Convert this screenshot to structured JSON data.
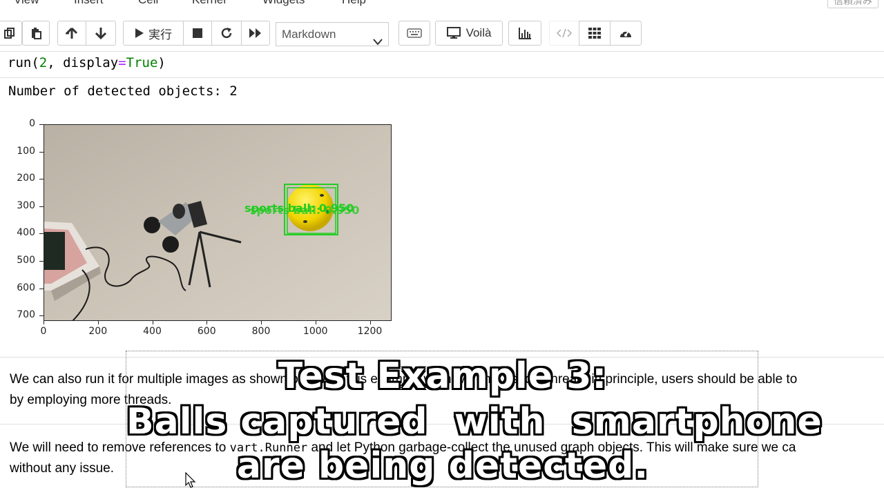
{
  "menubar": {
    "items": [
      "View",
      "Insert",
      "Cell",
      "Kernel",
      "Widgets",
      "Help"
    ],
    "trusted": "信頼済み"
  },
  "toolbar": {
    "run_label": "実行",
    "cell_type": "Markdown",
    "voila_label": "Voilà",
    "icons": [
      "copy-icon",
      "paste-icon",
      "arrow-up-icon",
      "arrow-down-icon",
      "play-icon",
      "stop-icon",
      "restart-icon",
      "fast-forward-icon",
      "keyboard-icon",
      "monitor-icon",
      "bar-chart-icon",
      "code-icon",
      "grid-icon",
      "dashboard-icon"
    ]
  },
  "code_cell": {
    "fn": "run(",
    "arg1": "2",
    "mid": ", display",
    "eq": "=",
    "kw": "True",
    "close": ")"
  },
  "output": {
    "text": "Number of detected objects: 2",
    "detection_label": "sports ball: 0.950"
  },
  "chart_data": {
    "type": "image",
    "x_ticks": [
      "0",
      "200",
      "400",
      "600",
      "800",
      "1000",
      "1200"
    ],
    "y_ticks": [
      "0",
      "100",
      "200",
      "300",
      "400",
      "500",
      "600",
      "700"
    ],
    "xlim": [
      0,
      1280
    ],
    "ylim": [
      720,
      0
    ]
  },
  "markdown": {
    "p1_line1": "We can also run it for multiple images as shown below. In this example we have only used 1 thread; in principle, users should be able to",
    "p1_line2": "by employing more threads.",
    "p2_line1a": "We will need to remove references to ",
    "p2_code": "vart.Runner",
    "p2_line1b": " and let Python garbage-collect the unused graph objects. This will make sure we ca",
    "p2_line2": "without any issue."
  },
  "subtitle": {
    "line1": "Test Example 3:",
    "line2": "Balls captured  with  smartphone",
    "line3": "are being detected."
  },
  "colors": {
    "detection_box": "#22cc22",
    "code_number": "#008000",
    "code_operator": "#aa22ff"
  }
}
